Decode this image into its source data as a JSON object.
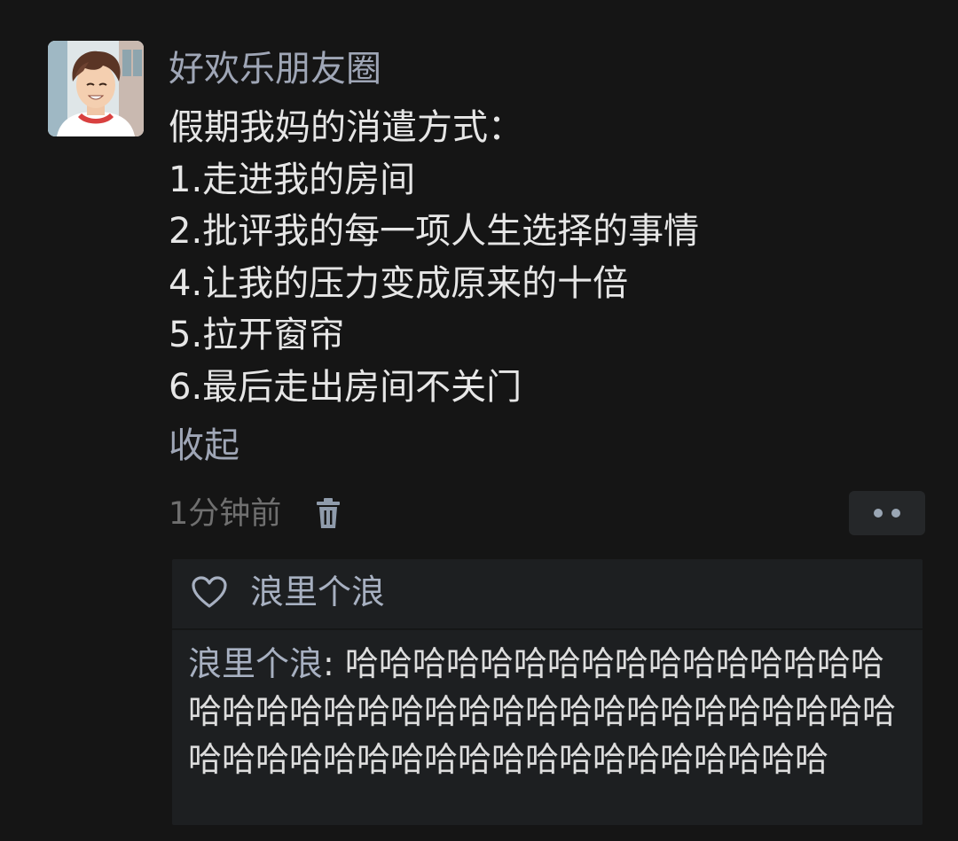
{
  "post": {
    "username": "好欢乐朋友圈",
    "content_lines": [
      "假期我妈的消遣方式：",
      "1.走进我的房间",
      "2.批评我的每一项人生选择的事情",
      "4.让我的压力变成原来的十倍",
      "5.拉开窗帘",
      "6.最后走出房间不关门"
    ],
    "collapse_label": "收起",
    "timestamp": "1分钟前"
  },
  "interactions": {
    "likes": "浪里个浪",
    "comment": {
      "author": "浪里个浪",
      "separator": ": ",
      "text": "哈哈哈哈哈哈哈哈哈哈哈哈哈哈哈哈哈哈哈哈哈哈哈哈哈哈哈哈哈哈哈哈哈哈哈哈哈哈哈哈哈哈哈哈哈哈哈哈哈哈哈哈哈哈哈哈"
    }
  },
  "icons": {
    "trash": "trash-icon",
    "more": "more-dots-icon",
    "heart": "heart-outline-icon"
  },
  "colors": {
    "background": "#151515",
    "name_blue": "#9fa6b6",
    "text": "#e6e6e6",
    "muted": "#6f6f6f",
    "panel": "#1d1f21"
  }
}
